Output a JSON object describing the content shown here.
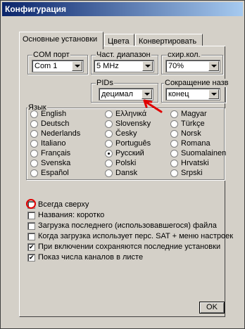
{
  "window": {
    "title": "Конфигурация"
  },
  "tabs": [
    "Основные установки",
    "Цвета",
    "Конвертировать"
  ],
  "groups": {
    "com": {
      "label": "COM порт",
      "value": "Com 1"
    },
    "freq": {
      "label": "Част. диапазон",
      "value": "5 MHz"
    },
    "sym": {
      "label": "схир.кол.",
      "value": "70%"
    },
    "pids": {
      "label": "PIDs",
      "value": "децимал"
    },
    "abbrev": {
      "label": "Сокращение назв",
      "value": "конец"
    }
  },
  "language": {
    "label": "Язык",
    "selected": "Русский",
    "col1": [
      "English",
      "Deutsch",
      "Nederlands",
      "Italiano",
      "Français",
      "Svenska",
      "Español"
    ],
    "col2": [
      "Ελληνικά",
      "Slovensky",
      "Česky",
      "Português",
      "Русский",
      "Polski",
      "Dansk"
    ],
    "col3": [
      "Magyar",
      "Türkçe",
      "Norsk",
      "Romana",
      "Suomalainen",
      "Hrvatski",
      "Srpski"
    ]
  },
  "options": [
    {
      "label": "Всегда сверху",
      "checked": false
    },
    {
      "label": "Названия: коротко",
      "checked": false
    },
    {
      "label": "Загрузка последнего (использовавшегося) файла",
      "checked": false
    },
    {
      "label": "Когда загрузка использует перс. SAT + меню настроек",
      "checked": false
    },
    {
      "label": "При включении сохраняются последние установки",
      "checked": true
    },
    {
      "label": "Показ числа каналов в листе",
      "checked": true
    }
  ],
  "buttons": {
    "ok": "OK"
  },
  "colors": {
    "titlebar": "#0a246a",
    "annotation": "#e00000",
    "face": "#d4d0c8"
  }
}
